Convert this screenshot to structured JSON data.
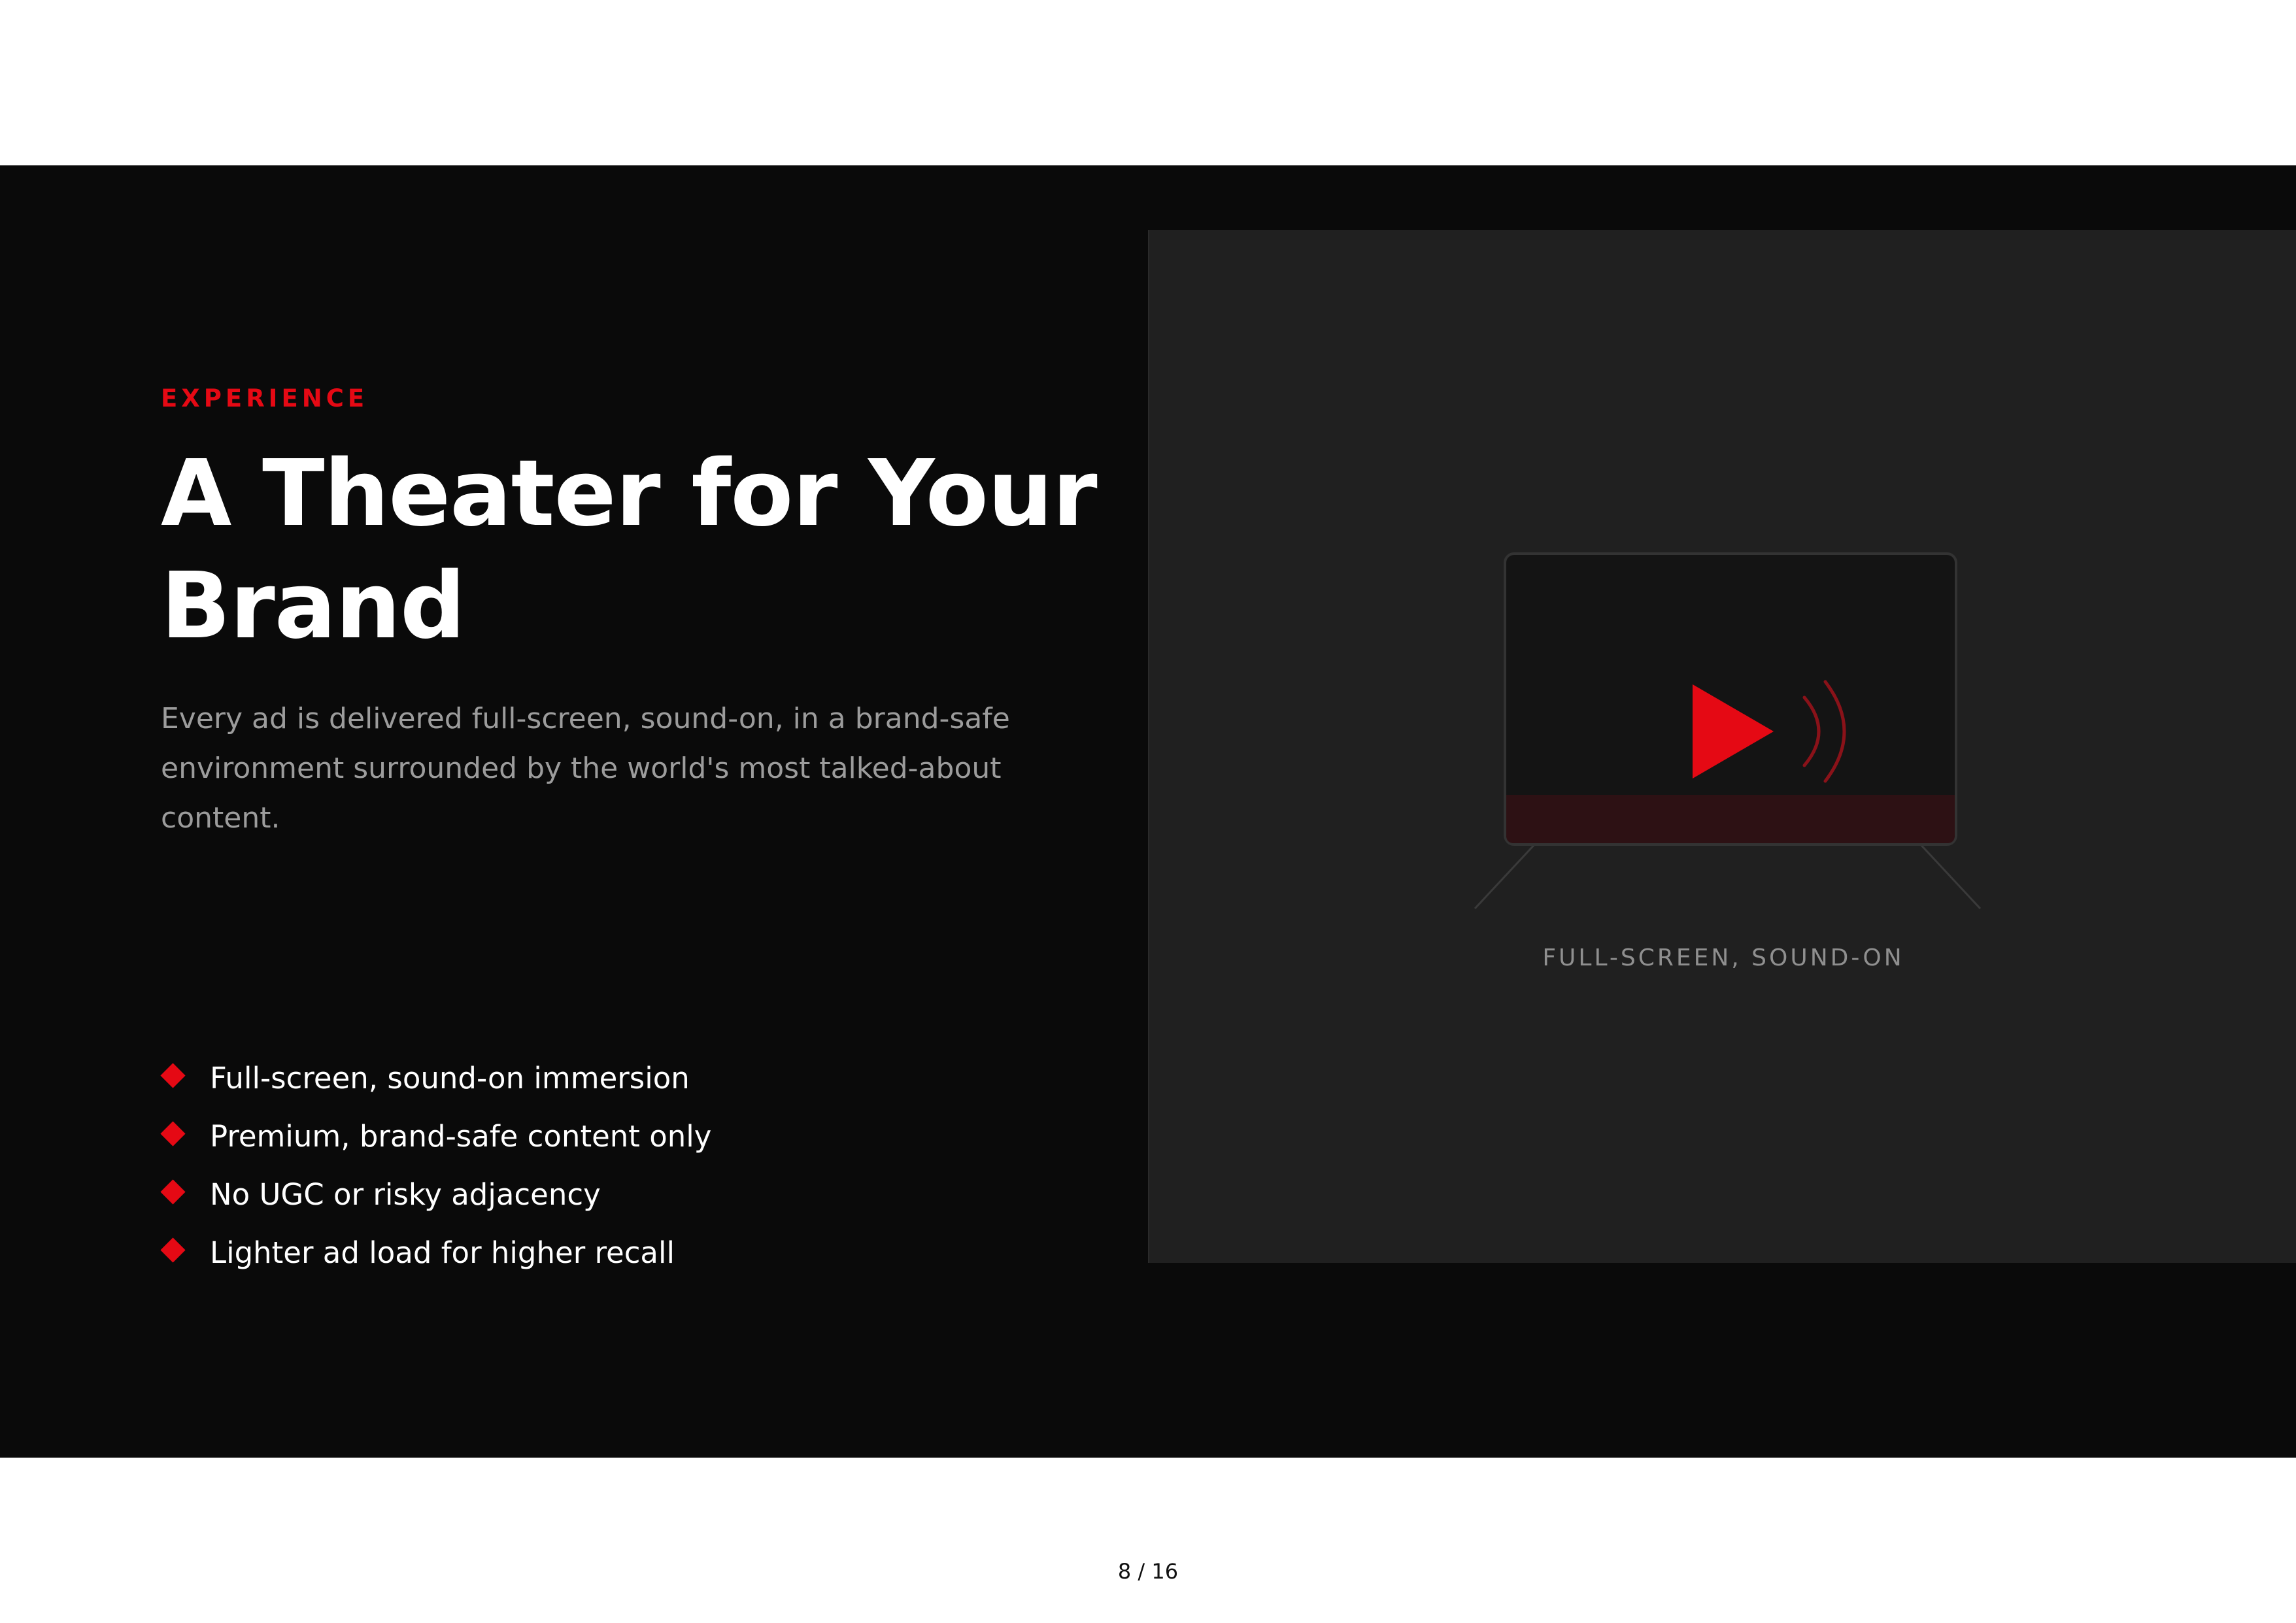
{
  "slide": {
    "eyebrow": "EXPERIENCE",
    "headline": "A Theater for Your Brand",
    "body": "Every ad is delivered full-screen, sound-on, in a brand-safe environment surrounded by the world's most talked-about content.",
    "bullets": [
      "Full-screen, sound-on immersion",
      "Premium, brand-safe content only",
      "No UGC or risky adjacency",
      "Lighter ad load for higher recall"
    ],
    "bullet_icon": "diamond-icon"
  },
  "illustration": {
    "icons": [
      "tv-icon",
      "play-icon",
      "sound-wave-icon"
    ],
    "caption": "FULL-SCREEN, SOUND-ON"
  },
  "footer": {
    "page_number": "8 / 16"
  },
  "colors": {
    "accent": "#e50914",
    "slide_background": "#0a0a0a",
    "panel_background": "#202020",
    "body_text": "#9c9c9c"
  }
}
